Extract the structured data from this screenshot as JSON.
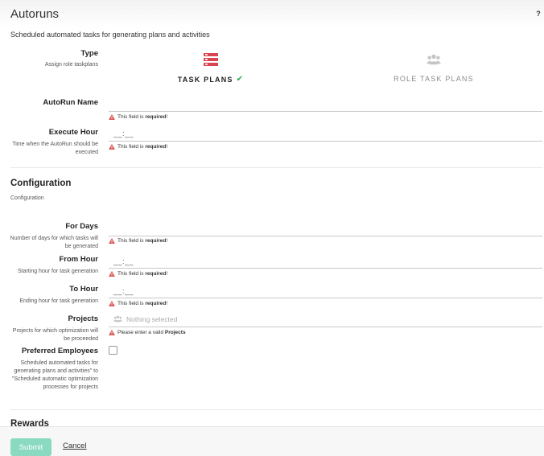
{
  "header": {
    "title": "Autoruns",
    "help_glyph": "?"
  },
  "subtitle": "Scheduled automated tasks for generating plans and activities",
  "type": {
    "label": "Type",
    "help": "Assign role taskplans",
    "options": [
      {
        "label": "TASK PLANS",
        "icon": "tasks-icon",
        "selected": true,
        "check": "✔"
      },
      {
        "label": "ROLE TASK PLANS",
        "icon": "people-icon",
        "selected": false
      }
    ]
  },
  "autorun_name": {
    "label": "AutoRun Name",
    "value": "",
    "error_prefix": "This field is",
    "error_bold": "required",
    "error_suffix": "!"
  },
  "execute_hour": {
    "label": "Execute Hour",
    "help": "Time when the AutoRun should be executed",
    "value": "__:__",
    "error_prefix": "This field is",
    "error_bold": "required",
    "error_suffix": "!"
  },
  "configuration": {
    "title": "Configuration",
    "subtitle": "Configuration",
    "for_days": {
      "label": "For Days",
      "help": "Number of days for which tasks will be generated",
      "value": "",
      "error_prefix": "This field is",
      "error_bold": "required",
      "error_suffix": "!"
    },
    "from_hour": {
      "label": "From Hour",
      "help": "Starting hour for task generation",
      "value": "__:__",
      "error_prefix": "This field is",
      "error_bold": "required",
      "error_suffix": "!"
    },
    "to_hour": {
      "label": "To Hour",
      "help": "Ending hour for task generation",
      "value": "__:__",
      "error_prefix": "This field is",
      "error_bold": "required",
      "error_suffix": "!"
    },
    "projects": {
      "label": "Projects",
      "help": "Projects for which optimization will be proceeded",
      "placeholder": "Nothing selected",
      "error_prefix": "Please enter a valid",
      "error_bold": "Projects",
      "error_suffix": ""
    },
    "preferred_employees": {
      "label": "Preferred Employees",
      "help": "Scheduled automated tasks for generating plans and activities\" to \"Scheduled automatic optimization processes for projects",
      "checked": false
    }
  },
  "rewards": {
    "title": "Rewards"
  },
  "footer": {
    "submit_label": "Submit",
    "cancel_label": "Cancel"
  },
  "colors": {
    "accent": "#8ad9c1",
    "error": "#d9534f",
    "task_icon": "#d64550",
    "check": "#27a844"
  }
}
